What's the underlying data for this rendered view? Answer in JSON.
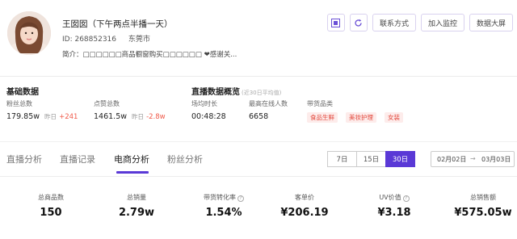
{
  "profile": {
    "name": "王囡囡（下午两点半播一天）",
    "id_label": "ID: 268852316",
    "city": "东莞市",
    "intro": "简介：□□□□□□商品橱窗购买□□□□□□ ❤感谢关..."
  },
  "top_actions": {
    "icons": [
      "qr-code-icon",
      "refresh-icon"
    ],
    "contact": "联系方式",
    "monitor": "加入监控",
    "dashboard": "数据大屏"
  },
  "basic": {
    "title": "基础数据",
    "fans_label": "粉丝总数",
    "fans_value": "179.85w",
    "fans_yest": "昨日",
    "fans_delta": "+241",
    "likes_label": "点赞总数",
    "likes_value": "1461.5w",
    "likes_yest": "昨日",
    "likes_delta": "-2.8w"
  },
  "live": {
    "title": "直播数据概览",
    "subtitle": "(近30日平均值)",
    "duration_label": "场均时长",
    "duration_value": "00:48:28",
    "online_label": "最高在线人数",
    "online_value": "6658",
    "category_label": "带货品类",
    "categories": [
      "食品生鲜",
      "美妆护理",
      "女装"
    ]
  },
  "tabs": [
    "直播分析",
    "直播记录",
    "电商分析",
    "粉丝分析"
  ],
  "active_tab": "电商分析",
  "ranges": [
    "7日",
    "15日",
    "30日"
  ],
  "active_range": "30日",
  "date_range": {
    "start": "02月02日",
    "sep": "→",
    "end": "03月03日"
  },
  "metrics": [
    {
      "label": "总商品数",
      "value": "150",
      "info": false
    },
    {
      "label": "总销量",
      "value": "2.79w",
      "info": false
    },
    {
      "label": "带货转化率",
      "value": "1.54%",
      "info": true
    },
    {
      "label": "客单价",
      "value": "¥206.19",
      "info": false
    },
    {
      "label": "UV价值",
      "value": "¥3.18",
      "info": true
    },
    {
      "label": "总销售额",
      "value": "¥575.05w",
      "info": false
    }
  ],
  "colors": {
    "accent": "#5a39d6",
    "negative": "#f05a4a",
    "tag_bg": "#fdeceb"
  }
}
